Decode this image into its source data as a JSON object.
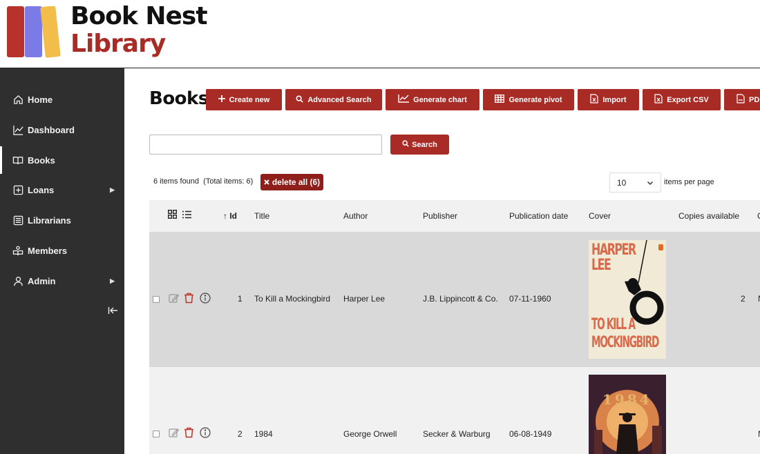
{
  "header": {
    "logo_line1": "Book Nest",
    "logo_line2": "Library",
    "brand_color": "#a82b26"
  },
  "sidebar": {
    "items": [
      {
        "label": "Home",
        "icon": "home-icon",
        "active": false,
        "has_submenu": false
      },
      {
        "label": "Dashboard",
        "icon": "chart-line-icon",
        "active": false,
        "has_submenu": false
      },
      {
        "label": "Books",
        "icon": "book-open-icon",
        "active": true,
        "has_submenu": false
      },
      {
        "label": "Loans",
        "icon": "plus-square-icon",
        "active": false,
        "has_submenu": true
      },
      {
        "label": "Librarians",
        "icon": "list-icon",
        "active": false,
        "has_submenu": false
      },
      {
        "label": "Members",
        "icon": "reader-icon",
        "active": false,
        "has_submenu": false
      },
      {
        "label": "Admin",
        "icon": "user-icon",
        "active": false,
        "has_submenu": true
      }
    ],
    "collapse_icon": "collapse-left-icon"
  },
  "main": {
    "title": "Books",
    "toolbar": [
      {
        "label": "Create new",
        "icon": "plus-icon"
      },
      {
        "label": "Advanced Search",
        "icon": "search-icon"
      },
      {
        "label": "Generate chart",
        "icon": "chart-icon"
      },
      {
        "label": "Generate pivot",
        "icon": "table-icon"
      },
      {
        "label": "Import",
        "icon": "excel-icon"
      },
      {
        "label": "Export CSV",
        "icon": "excel-icon"
      },
      {
        "label": "PDF",
        "icon": "pdf-icon"
      }
    ],
    "search": {
      "value": "",
      "button_label": "Search"
    },
    "items_found": "6 items found",
    "total_items": "(Total items: 6)",
    "delete_all_label": "delete all (6)",
    "per_page": {
      "value": "10",
      "label": "items per page"
    }
  },
  "table": {
    "view_icons": [
      "grid-view-icon",
      "list-view-icon"
    ],
    "columns": [
      "↑ Id",
      "Title",
      "Author",
      "Publisher",
      "Publication date",
      "Cover",
      "Copies available",
      "C"
    ],
    "rows": [
      {
        "id": "1",
        "title": "To Kill a Mockingbird",
        "author": "Harper Lee",
        "publisher": "J.B. Lippincott & Co.",
        "publication_date": "07-11-1960",
        "cover_text": [
          "HARPER",
          "LEE",
          "TO KILL A",
          "MOCKINGBIRD"
        ],
        "copies": "2",
        "extra": "N"
      },
      {
        "id": "2",
        "title": "1984",
        "author": "George Orwell",
        "publisher": "Secker & Warburg",
        "publication_date": "06-08-1949",
        "cover_text": [
          "1984"
        ],
        "copies": "",
        "extra": "N"
      }
    ]
  }
}
